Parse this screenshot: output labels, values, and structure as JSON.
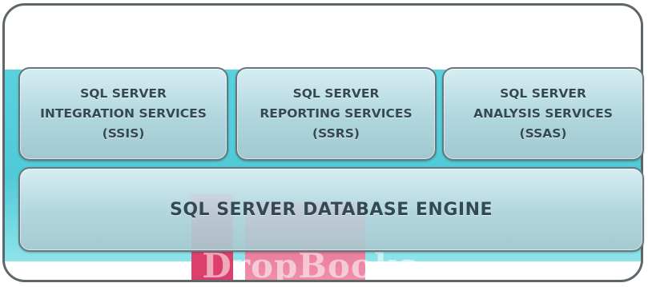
{
  "watermark": {
    "text": "DropBooks"
  },
  "services": [
    {
      "line1": "SQL SERVER",
      "line2": "INTEGRATION SERVICES",
      "line3": "(SSIS)"
    },
    {
      "line1": "SQL SERVER",
      "line2": "REPORTING SERVICES",
      "line3": "(SSRS)"
    },
    {
      "line1": "SQL SERVER",
      "line2": "ANALYSIS SERVICES",
      "line3": "(SSAS)"
    }
  ],
  "engine": {
    "label": "SQL SERVER DATABASE ENGINE"
  },
  "colors": {
    "band": "#4fcad6",
    "box_border": "#66787e",
    "text": "#344a53",
    "frame_border": "#5d676b"
  }
}
